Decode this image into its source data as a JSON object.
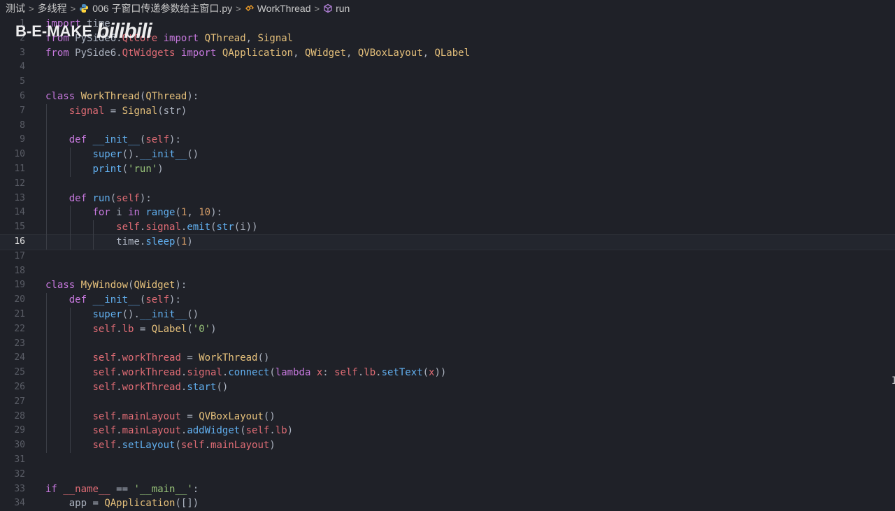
{
  "breadcrumb": {
    "items": [
      "测试",
      "多线程",
      "006 子窗口传递参数给主窗口.py",
      "WorkThread",
      "run"
    ]
  },
  "watermark": {
    "left": "B-E-MAKE",
    "right": "bilibili"
  },
  "editor": {
    "current_line": 16,
    "line_numbers": [
      "1",
      "2",
      "3",
      "4",
      "5",
      "6",
      "7",
      "8",
      "9",
      "10",
      "11",
      "12",
      "13",
      "14",
      "15",
      "16",
      "17",
      "18",
      "19",
      "20",
      "21",
      "22",
      "23",
      "24",
      "25",
      "26",
      "27",
      "28",
      "29",
      "30",
      "31",
      "32",
      "33",
      "34"
    ],
    "lines": [
      "import time",
      "from PySide6.QtCore import QThread, Signal",
      "from PySide6.QtWidgets import QApplication, QWidget, QVBoxLayout, QLabel",
      "",
      "",
      "class WorkThread(QThread):",
      "    signal = Signal(str)",
      "",
      "    def __init__(self):",
      "        super().__init__()",
      "        print('run')",
      "",
      "    def run(self):",
      "        for i in range(1, 10):",
      "            self.signal.emit(str(i))",
      "            time.sleep(1)",
      "",
      "",
      "class MyWindow(QWidget):",
      "    def __init__(self):",
      "        super().__init__()",
      "        self.lb = QLabel('0')",
      "",
      "        self.workThread = WorkThread()",
      "        self.workThread.signal.connect(lambda x: self.lb.setText(x))",
      "        self.workThread.start()",
      "",
      "        self.mainLayout = QVBoxLayout()",
      "        self.mainLayout.addWidget(self.lb)",
      "        self.setLayout(self.mainLayout)",
      "",
      "",
      "if __name__ == '__main__':",
      "    app = QApplication([])"
    ]
  },
  "colors": {
    "background": "#1f2128",
    "keyword": "#c678dd",
    "class": "#e5c07b",
    "function": "#61afef",
    "string": "#98c379",
    "number": "#d19a66",
    "attribute": "#e06c75",
    "default": "#abb2bf"
  }
}
